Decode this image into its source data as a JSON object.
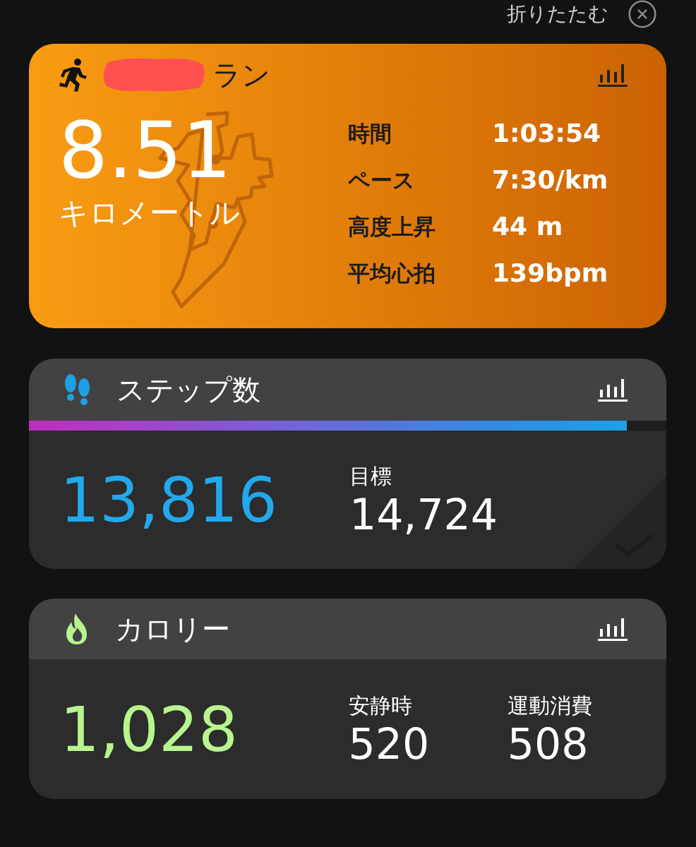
{
  "header": {
    "collapse_label": "折りたたむ"
  },
  "activity": {
    "title": "ラン",
    "distance": "8.51",
    "unit": "キロメートル",
    "redacted": true,
    "stats": [
      {
        "label": "時間",
        "value": "1:03:54"
      },
      {
        "label": "ペース",
        "value": "7:30/km"
      },
      {
        "label": "高度上昇",
        "value": "44 m"
      },
      {
        "label": "平均心拍",
        "value": "139bpm"
      }
    ]
  },
  "steps": {
    "title": "ステップ数",
    "level": 0.938,
    "value": "13,816",
    "goal_label": "目標",
    "goal_value": "14,724",
    "goal_reached": false
  },
  "calories": {
    "title": "カロリー",
    "value": "1,028",
    "parts": [
      {
        "label": "安静時",
        "value": "520"
      },
      {
        "label": "運動消費",
        "value": "508"
      }
    ]
  }
}
